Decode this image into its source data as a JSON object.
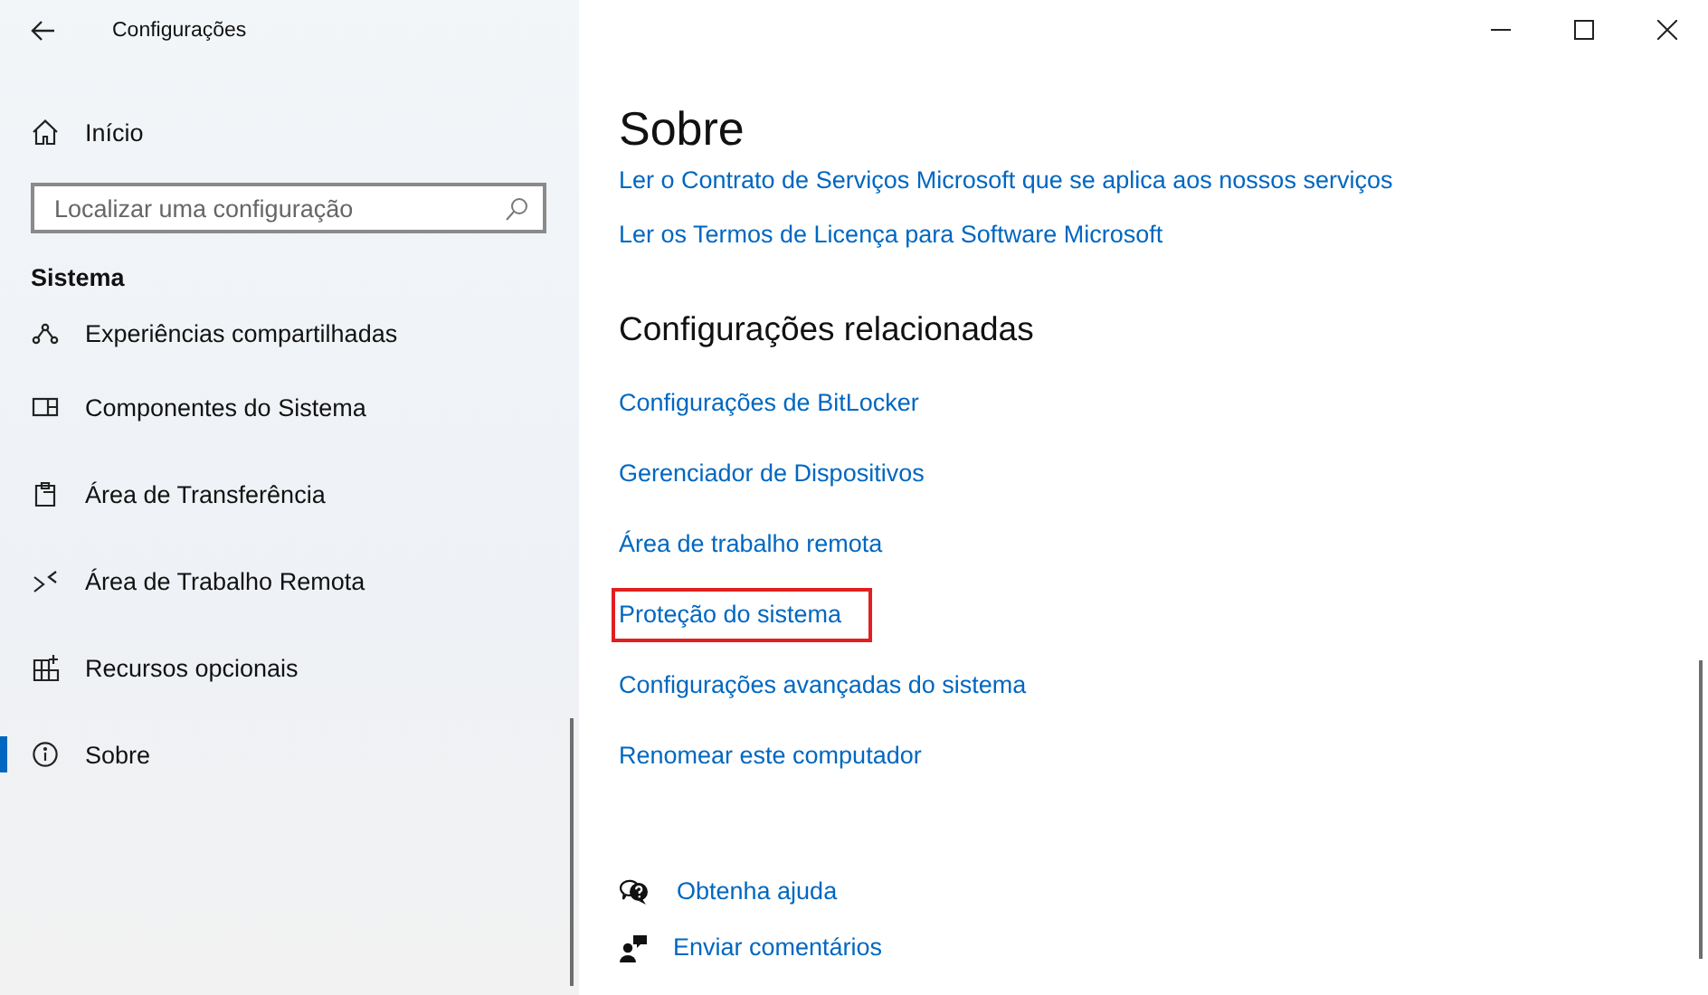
{
  "window": {
    "title": "Configurações"
  },
  "sidebar": {
    "home": "Início",
    "search": {
      "placeholder": "Localizar uma configuração"
    },
    "section": "Sistema",
    "items": [
      {
        "label": "Experiências compartilhadas",
        "selected": false
      },
      {
        "label": "Componentes do Sistema",
        "selected": false
      },
      {
        "label": "Área de Transferência",
        "selected": false
      },
      {
        "label": "Área de Trabalho Remota",
        "selected": false
      },
      {
        "label": "Recursos opcionais",
        "selected": false
      },
      {
        "label": "Sobre",
        "selected": true
      }
    ]
  },
  "content": {
    "title": "Sobre",
    "top_links": [
      "Ler o Contrato de Serviços Microsoft que se aplica aos nossos serviços",
      "Ler os Termos de Licença para Software Microsoft"
    ],
    "related": {
      "title": "Configurações relacionadas",
      "links": [
        {
          "label": "Configurações de BitLocker",
          "highlighted": false
        },
        {
          "label": "Gerenciador de Dispositivos",
          "highlighted": false
        },
        {
          "label": "Área de trabalho remota",
          "highlighted": false
        },
        {
          "label": "Proteção do sistema",
          "highlighted": true
        },
        {
          "label": "Configurações avançadas do sistema",
          "highlighted": false
        },
        {
          "label": "Renomear este computador",
          "highlighted": false
        }
      ]
    },
    "help": [
      "Obtenha ajuda",
      "Enviar comentários"
    ]
  }
}
